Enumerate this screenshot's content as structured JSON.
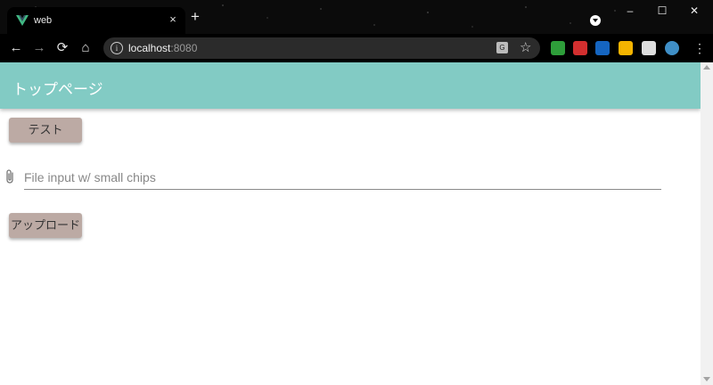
{
  "browser": {
    "tab": {
      "title": "web",
      "close_glyph": "×",
      "favicon": "vue-logo-icon"
    },
    "new_tab_glyph": "+",
    "window": {
      "minimize": "–",
      "maximize": "☐",
      "close": "✕"
    },
    "nav": {
      "back": "←",
      "forward": "→",
      "reload": "⟳",
      "home": "⌂"
    },
    "address": {
      "host": "localhost",
      "port": ":8080",
      "info_glyph": "i"
    },
    "translate_glyph": "G",
    "bookmark_glyph": "☆",
    "menu_glyph": "⋮",
    "extensions": [
      {
        "name": "green-extension-icon",
        "color": "#2e9e3a"
      },
      {
        "name": "pdf-extension-icon",
        "color": "#d32f2f"
      },
      {
        "name": "ui-extension-icon",
        "color": "#1565c0"
      },
      {
        "name": "drive-extension-icon",
        "color": "#f4b400"
      },
      {
        "name": "puzzle-extension-icon",
        "color": "#dddddd"
      },
      {
        "name": "profile-avatar-icon",
        "color": "#3f8fc7"
      }
    ]
  },
  "app": {
    "header_title": "トップページ",
    "test_button": "テスト",
    "file_input_placeholder": "File input w/ small chips",
    "upload_button": "アップロード",
    "colors": {
      "appbar": "#82cbc4",
      "button": "#bcaaa4"
    }
  }
}
